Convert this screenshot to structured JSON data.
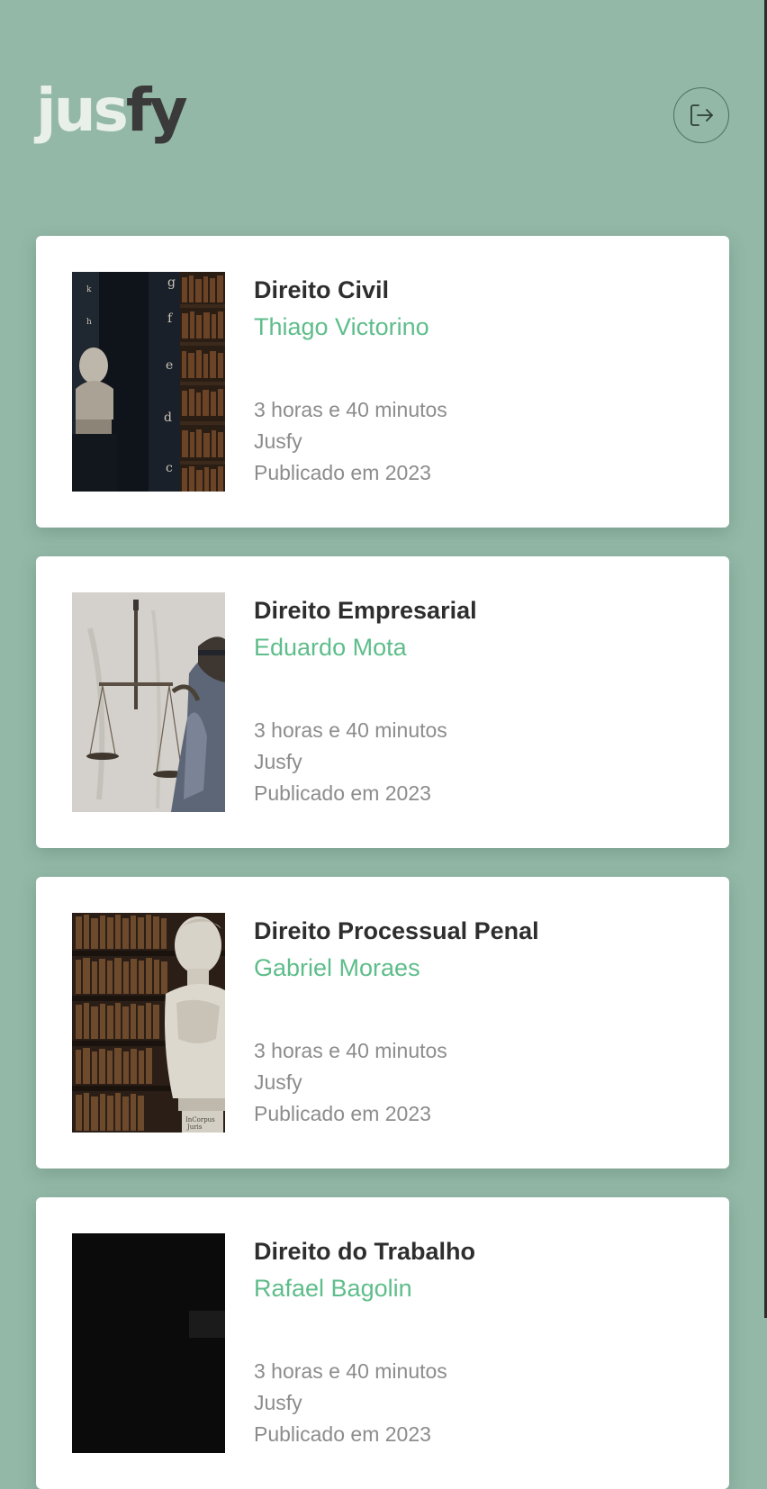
{
  "brand": {
    "logo_part1": "jus",
    "logo_part2": "fy",
    "light_color": "#e9efe9",
    "dark_color": "#3a3a3a"
  },
  "header": {
    "logout_icon": "logout-icon"
  },
  "theme": {
    "background": "#93b8a7",
    "accent": "#5ebd8a"
  },
  "courses": [
    {
      "title": "Direito Civil",
      "author": "Thiago Victorino",
      "duration": "3 horas e 40 minutos",
      "publisher": "Jusfy",
      "published": "Publicado em 2023",
      "thumbnail": "library-bust-image"
    },
    {
      "title": "Direito Empresarial",
      "author": "Eduardo Mota",
      "duration": "3 horas e 40 minutos",
      "publisher": "Jusfy",
      "published": "Publicado em 2023",
      "thumbnail": "lady-justice-image"
    },
    {
      "title": "Direito Processual Penal",
      "author": "Gabriel Moraes",
      "duration": "3 horas e 40 minutos",
      "publisher": "Jusfy",
      "published": "Publicado em 2023",
      "thumbnail": "statue-bookshelf-image"
    },
    {
      "title": "Direito do Trabalho",
      "author": "Rafael Bagolin",
      "duration": "3 horas e 40 minutos",
      "publisher": "Jusfy",
      "published": "Publicado em 2023",
      "thumbnail": "dark-image"
    }
  ]
}
